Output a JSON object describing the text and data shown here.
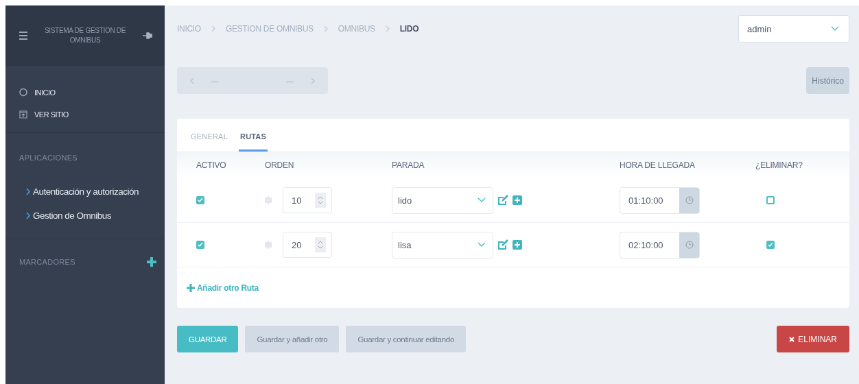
{
  "sidebar": {
    "title": "SISTEMA DE GESTION DE OMNIBUS",
    "links": [
      {
        "kind": "home",
        "label": "INICIO"
      },
      {
        "kind": "site",
        "label": "VER SITIO"
      }
    ],
    "apps_heading": "APLICACIONES",
    "apps": [
      {
        "label": "Autenticación y autorización"
      },
      {
        "label": "Gestion de Omnibus"
      }
    ],
    "bookmarks_heading": "MARCADORES"
  },
  "breadcrumb": [
    {
      "label": "INICIO",
      "current": false
    },
    {
      "label": "GESTION DE OMNIBUS",
      "current": false
    },
    {
      "label": "OMNIBUS",
      "current": false
    },
    {
      "label": "LIDO",
      "current": true
    }
  ],
  "user_select": {
    "value": "admin"
  },
  "pager": {
    "prev": "—",
    "next": "—"
  },
  "history_button": "Histórico",
  "tabs": [
    {
      "label": "GENERAL",
      "selected": false
    },
    {
      "label": "RUTAS",
      "selected": true
    }
  ],
  "table": {
    "columns": [
      "ACTIVO",
      "ORDEN",
      "PARADA",
      "HORA DE LLEGADA",
      "¿ELIMINAR?"
    ],
    "rows": [
      {
        "active": true,
        "order": "10",
        "stop": "lido",
        "time": "01:10:00",
        "delete": false
      },
      {
        "active": true,
        "order": "20",
        "stop": "lisa",
        "time": "02:10:00",
        "delete": true
      }
    ]
  },
  "add_link": "Añadir otro Ruta",
  "actions": [
    {
      "kind": "primary",
      "label": "GUARDAR"
    },
    {
      "kind": "secondary",
      "label": "Guardar y añadir otro"
    },
    {
      "kind": "secondary",
      "label": "Guardar y continuar editando"
    }
  ],
  "delete_button": "ELIMINAR"
}
